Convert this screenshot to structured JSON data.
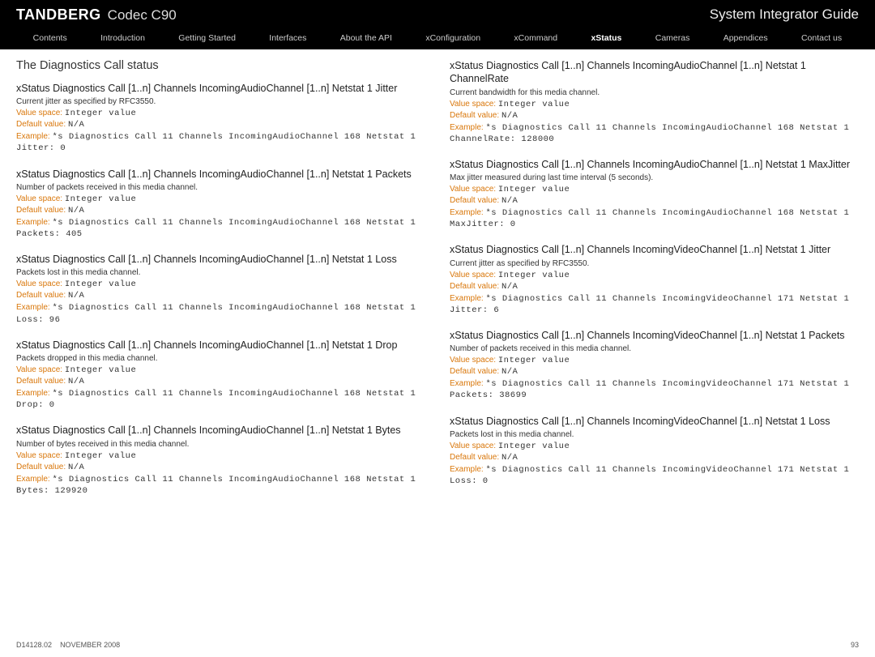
{
  "header": {
    "brand": "TANDBERG",
    "product": "Codec C90",
    "doc_title": "System Integrator Guide"
  },
  "nav": {
    "items": [
      {
        "label": "Contents"
      },
      {
        "label": "Introduction"
      },
      {
        "label": "Getting Started"
      },
      {
        "label": "Interfaces"
      },
      {
        "label": "About the API"
      },
      {
        "label": "xConfiguration"
      },
      {
        "label": "xCommand"
      },
      {
        "label": "xStatus",
        "active": true
      },
      {
        "label": "Cameras"
      },
      {
        "label": "Appendices"
      },
      {
        "label": "Contact us"
      }
    ]
  },
  "section_heading": "The Diagnostics Call status",
  "labels": {
    "value_space": "Value space:",
    "default_value": "Default value:",
    "example": "Example:"
  },
  "left": [
    {
      "title": "xStatus Diagnostics Call [1..n] Channels IncomingAudioChannel [1..n] Netstat 1 Jitter",
      "desc": "Current jitter as specified by RFC3550.",
      "value_space": "Integer value",
      "default_value": "N/A",
      "example": "*s Diagnostics Call 11 Channels IncomingAudioChannel 168 Netstat 1 Jitter: 0"
    },
    {
      "title": "xStatus Diagnostics Call [1..n] Channels IncomingAudioChannel [1..n] Netstat 1 Packets",
      "desc": "Number of packets received in this media channel.",
      "value_space": "Integer value",
      "default_value": "N/A",
      "example": "*s Diagnostics Call 11 Channels IncomingAudioChannel 168 Netstat 1 Packets: 405"
    },
    {
      "title": "xStatus Diagnostics Call [1..n] Channels IncomingAudioChannel [1..n] Netstat 1 Loss",
      "desc": "Packets lost in this media channel.",
      "value_space": "Integer value",
      "default_value": "N/A",
      "example": "*s Diagnostics Call 11 Channels IncomingAudioChannel 168 Netstat 1 Loss: 96"
    },
    {
      "title": "xStatus Diagnostics Call [1..n] Channels IncomingAudioChannel [1..n] Netstat 1 Drop",
      "desc": "Packets dropped in this media channel.",
      "value_space": "Integer value",
      "default_value": "N/A",
      "example": "*s Diagnostics Call 11 Channels IncomingAudioChannel 168 Netstat 1 Drop: 0"
    },
    {
      "title": "xStatus Diagnostics Call [1..n] Channels IncomingAudioChannel [1..n] Netstat 1 Bytes",
      "desc": "Number of bytes received in this media channel.",
      "value_space": "Integer value",
      "default_value": "N/A",
      "example": "*s Diagnostics Call 11 Channels IncomingAudioChannel 168 Netstat 1 Bytes: 129920"
    }
  ],
  "right": [
    {
      "title": "xStatus Diagnostics Call [1..n] Channels IncomingAudioChannel [1..n] Netstat 1 ChannelRate",
      "desc": "Current bandwidth for this media channel.",
      "value_space": "Integer value",
      "default_value": "N/A",
      "example": "*s Diagnostics Call 11 Channels IncomingAudioChannel 168 Netstat 1 ChannelRate: 128000"
    },
    {
      "title": "xStatus Diagnostics Call [1..n] Channels IncomingAudioChannel [1..n] Netstat 1 MaxJitter",
      "desc": "Max jitter measured during last time interval (5 seconds).",
      "value_space": "Integer value",
      "default_value": "N/A",
      "example": "*s Diagnostics Call 11 Channels IncomingAudioChannel 168 Netstat 1 MaxJitter: 0"
    },
    {
      "title": "xStatus Diagnostics Call [1..n] Channels IncomingVideoChannel [1..n] Netstat 1 Jitter",
      "desc": "Current jitter as specified by RFC3550.",
      "value_space": "Integer value",
      "default_value": "N/A",
      "example": "*s Diagnostics Call 11 Channels IncomingVideoChannel 171 Netstat 1 Jitter: 6"
    },
    {
      "title": "xStatus Diagnostics Call [1..n] Channels IncomingVideoChannel [1..n] Netstat 1 Packets",
      "desc": "Number of packets received in this media channel.",
      "value_space": "Integer value",
      "default_value": "N/A",
      "example": "*s Diagnostics Call 11 Channels IncomingVideoChannel 171 Netstat 1 Packets: 38699"
    },
    {
      "title": "xStatus Diagnostics Call [1..n] Channels IncomingVideoChannel [1..n] Netstat 1 Loss",
      "desc": "Packets lost in this media channel.",
      "value_space": "Integer value",
      "default_value": "N/A",
      "example": "*s Diagnostics Call 11 Channels IncomingVideoChannel 171 Netstat 1 Loss: 0"
    }
  ],
  "footer": {
    "doc_id": "D14128.02",
    "date": "NOVEMBER 2008",
    "page": "93"
  }
}
